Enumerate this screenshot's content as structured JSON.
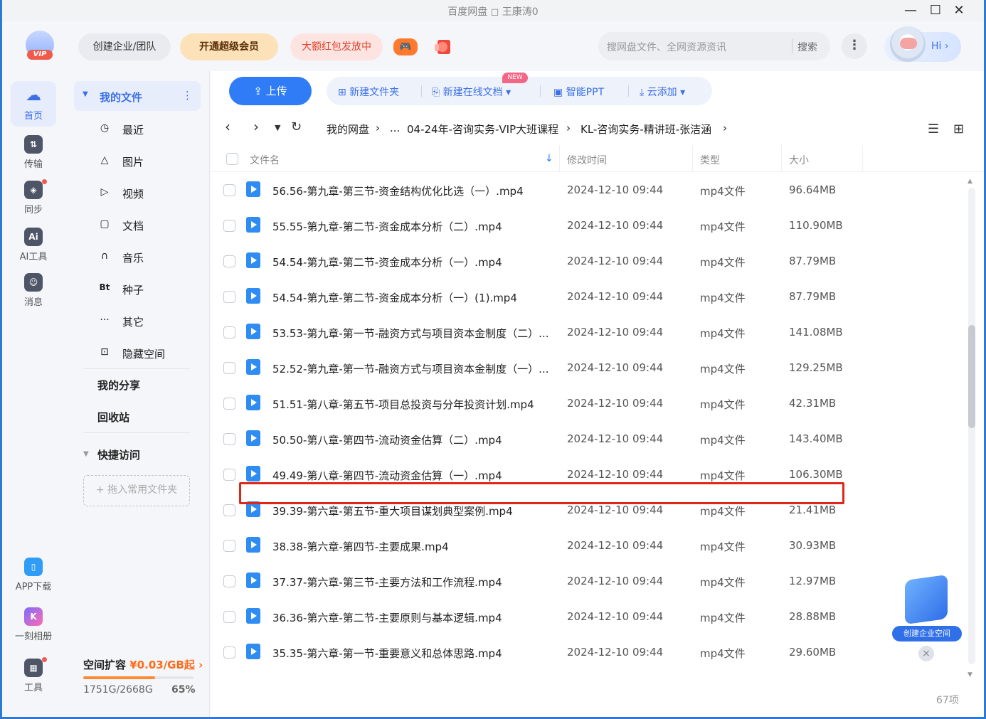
{
  "window": {
    "title": "百度网盘 ◻ 王康涛0",
    "minimize": "—",
    "maximize": "☐",
    "close": "✕"
  },
  "header": {
    "vip_badge": "VIP",
    "create_team": "创建企业/团队",
    "super_vip": "开通超级会员",
    "red_packet": "大额红包发放中",
    "search_placeholder": "搜网盘文件、全网资源资讯",
    "search_button": "搜索",
    "hi": "Hi ›"
  },
  "rail": {
    "home": "首页",
    "transfer": "传输",
    "sync": "同步",
    "ai_tools": "AI工具",
    "messages": "消息",
    "app_download": "APP下载",
    "album": "一刻相册",
    "tools": "工具"
  },
  "sidebar": {
    "my_files": "我的文件",
    "items": [
      {
        "label": "最近",
        "icon": "◷"
      },
      {
        "label": "图片",
        "icon": "△"
      },
      {
        "label": "视频",
        "icon": "▷"
      },
      {
        "label": "文档",
        "icon": "▢"
      },
      {
        "label": "音乐",
        "icon": "∩"
      },
      {
        "label": "种子",
        "icon": "Bt"
      },
      {
        "label": "其它",
        "icon": "···"
      },
      {
        "label": "隐藏空间",
        "icon": "⊡"
      }
    ],
    "my_share": "我的分享",
    "recycle": "回收站",
    "quick_access": "快捷访问",
    "quick_drop": "+ 拖入常用文件夹",
    "storage_title": "空间扩容",
    "storage_price": "¥0.03/GB起",
    "storage_used": "1751G/2668G",
    "storage_pct": "65%",
    "storage_fraction": 0.65
  },
  "toolbar": {
    "upload": "上传",
    "new_folder": "新建文件夹",
    "new_doc": "新建在线文档",
    "new_tag": "NEW",
    "smart_ppt": "智能PPT",
    "cloud_add": "云添加"
  },
  "breadcrumb": {
    "root": "我的网盘",
    "ellipsis": "...",
    "level1": "04-24年-咨询实务-VIP大班课程",
    "level2": "KL-咨询实务-精讲班-张洁涵"
  },
  "table": {
    "headers": {
      "name": "文件名",
      "mtime": "修改时间",
      "type": "类型",
      "size": "大小"
    },
    "rows": [
      {
        "name": "56.56-第九章-第三节-资金结构优化比选（一）.mp4",
        "mtime": "2024-12-10 09:44",
        "type": "mp4文件",
        "size": "96.64MB"
      },
      {
        "name": "55.55-第九章-第二节-资金成本分析（二）.mp4",
        "mtime": "2024-12-10 09:44",
        "type": "mp4文件",
        "size": "110.90MB"
      },
      {
        "name": "54.54-第九章-第二节-资金成本分析（一）.mp4",
        "mtime": "2024-12-10 09:44",
        "type": "mp4文件",
        "size": "87.79MB"
      },
      {
        "name": "54.54-第九章-第二节-资金成本分析（一）(1).mp4",
        "mtime": "2024-12-10 09:44",
        "type": "mp4文件",
        "size": "87.79MB"
      },
      {
        "name": "53.53-第九章-第一节-融资方式与项目资本金制度（二）...",
        "mtime": "2024-12-10 09:44",
        "type": "mp4文件",
        "size": "141.08MB"
      },
      {
        "name": "52.52-第九章-第一节-融资方式与项目资本金制度（一）...",
        "mtime": "2024-12-10 09:44",
        "type": "mp4文件",
        "size": "129.25MB"
      },
      {
        "name": "51.51-第八章-第五节-项目总投资与分年投资计划.mp4",
        "mtime": "2024-12-10 09:44",
        "type": "mp4文件",
        "size": "42.31MB"
      },
      {
        "name": "50.50-第八章-第四节-流动资金估算（二）.mp4",
        "mtime": "2024-12-10 09:44",
        "type": "mp4文件",
        "size": "143.40MB"
      },
      {
        "name": "49.49-第八章-第四节-流动资金估算（一）.mp4",
        "mtime": "2024-12-10 09:44",
        "type": "mp4文件",
        "size": "106.30MB"
      },
      {
        "name": "39.39-第六章-第五节-重大项目谋划典型案例.mp4",
        "mtime": "2024-12-10 09:44",
        "type": "mp4文件",
        "size": "21.41MB"
      },
      {
        "name": "38.38-第六章-第四节-主要成果.mp4",
        "mtime": "2024-12-10 09:44",
        "type": "mp4文件",
        "size": "30.93MB"
      },
      {
        "name": "37.37-第六章-第三节-主要方法和工作流程.mp4",
        "mtime": "2024-12-10 09:44",
        "type": "mp4文件",
        "size": "12.97MB"
      },
      {
        "name": "36.36-第六章-第二节-主要原则与基本逻辑.mp4",
        "mtime": "2024-12-10 09:44",
        "type": "mp4文件",
        "size": "28.88MB"
      },
      {
        "name": "35.35-第六章-第一节-重要意义和总体思路.mp4",
        "mtime": "2024-12-10 09:44",
        "type": "mp4文件",
        "size": "29.60MB"
      }
    ],
    "count": "67项"
  },
  "enterprise": {
    "label": "创建企业空间",
    "close": "×"
  },
  "colors": {
    "accent": "#2f7cf6",
    "highlight": "#e0261b",
    "orange": "#ff6a1a"
  }
}
